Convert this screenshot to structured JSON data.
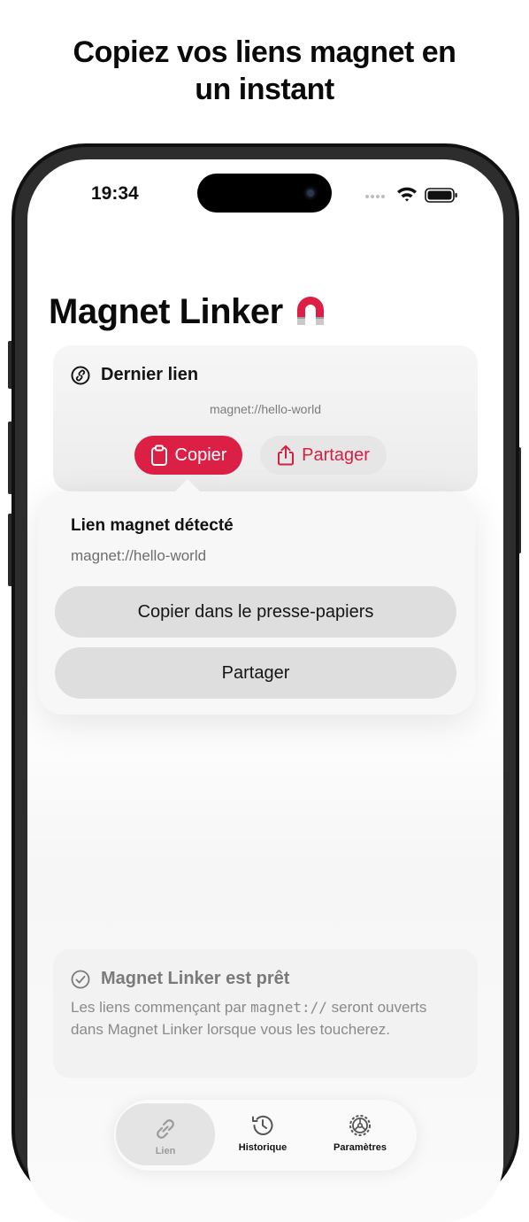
{
  "headline": {
    "line1": "Copiez vos liens magnet en",
    "line2": "un instant"
  },
  "status_bar": {
    "time": "19:34"
  },
  "app": {
    "title": "Magnet Linker"
  },
  "last_link": {
    "heading": "Dernier lien",
    "url": "magnet://hello-world",
    "copy_label": "Copier",
    "share_label": "Partager"
  },
  "popover": {
    "title": "Lien magnet détecté",
    "url": "magnet://hello-world",
    "copy_button": "Copier dans le presse-papiers",
    "share_button": "Partager"
  },
  "ready": {
    "heading": "Magnet Linker est prêt",
    "body_before": "Les liens commençant par",
    "body_code": "magnet://",
    "body_after": "seront ouverts dans Magnet Linker lorsque vous les toucherez."
  },
  "tabs": [
    {
      "label": "Lien",
      "icon": "link-icon",
      "active": true
    },
    {
      "label": "Historique",
      "icon": "history-icon",
      "active": false
    },
    {
      "label": "Paramètres",
      "icon": "gear-icon",
      "active": false
    }
  ],
  "colors": {
    "accent": "#dc1f45",
    "card_bg": "#f0f0f0",
    "secondary_button": "#dedede"
  }
}
